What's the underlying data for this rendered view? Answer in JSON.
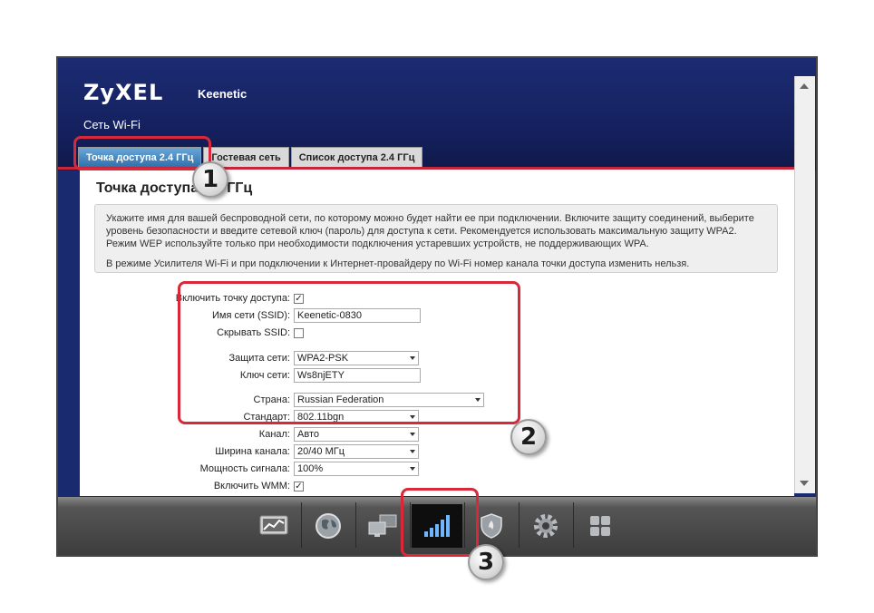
{
  "brand": {
    "logo": "ZyXEL",
    "product": "Keenetic"
  },
  "page_title": "Сеть Wi-Fi",
  "tabs": [
    {
      "label": "Точка доступа 2.4 ГГц",
      "active": true
    },
    {
      "label": "Гостевая сеть",
      "active": false
    },
    {
      "label": "Список доступа 2.4 ГГц",
      "active": false
    }
  ],
  "section_title": "Точка доступа 2.4 ГГц",
  "info": {
    "paragraph1": "Укажите имя для вашей беспроводной сети, по которому можно будет найти ее при подключении. Включите защиту соединений, выберите уровень безопасности и введите сетевой ключ (пароль) для доступа к сети. Рекомендуется использовать максимальную защиту WPA2. Режим WEP используйте только при необходимости подключения устаревших устройств, не поддерживающих WPA.",
    "paragraph2": "В режиме Усилителя Wi-Fi и при подключении к Интернет-провайдеру по Wi-Fi номер канала точки доступа изменить нельзя."
  },
  "form": {
    "enable_ap": {
      "label": "Включить точку доступа:",
      "checked": true,
      "mark": "✓"
    },
    "ssid": {
      "label": "Имя сети (SSID):",
      "value": "Keenetic-0830"
    },
    "hide_ssid": {
      "label": "Скрывать SSID:",
      "checked": false
    },
    "security": {
      "label": "Защита сети:",
      "value": "WPA2-PSK"
    },
    "key": {
      "label": "Ключ сети:",
      "value": "Ws8njETY"
    },
    "country": {
      "label": "Страна:",
      "value": "Russian Federation"
    },
    "standard": {
      "label": "Стандарт:",
      "value": "802.11bgn"
    },
    "channel": {
      "label": "Канал:",
      "value": "Авто"
    },
    "bandwidth": {
      "label": "Ширина канала:",
      "value": "20/40 МГц"
    },
    "power": {
      "label": "Мощность сигнала:",
      "value": "100%"
    },
    "wmm": {
      "label": "Включить WMM:",
      "checked": true,
      "mark": "✓"
    }
  },
  "taskbar": {
    "icons": [
      "monitor-chart-icon",
      "globe-icon",
      "computers-icon",
      "wifi-signal-icon",
      "shield-icon",
      "gear-icon",
      "apps-grid-icon"
    ],
    "active": "wifi-signal-icon"
  },
  "annotations": {
    "badge1": "1",
    "badge2": "2",
    "badge3": "3",
    "color": "#d8283a"
  }
}
